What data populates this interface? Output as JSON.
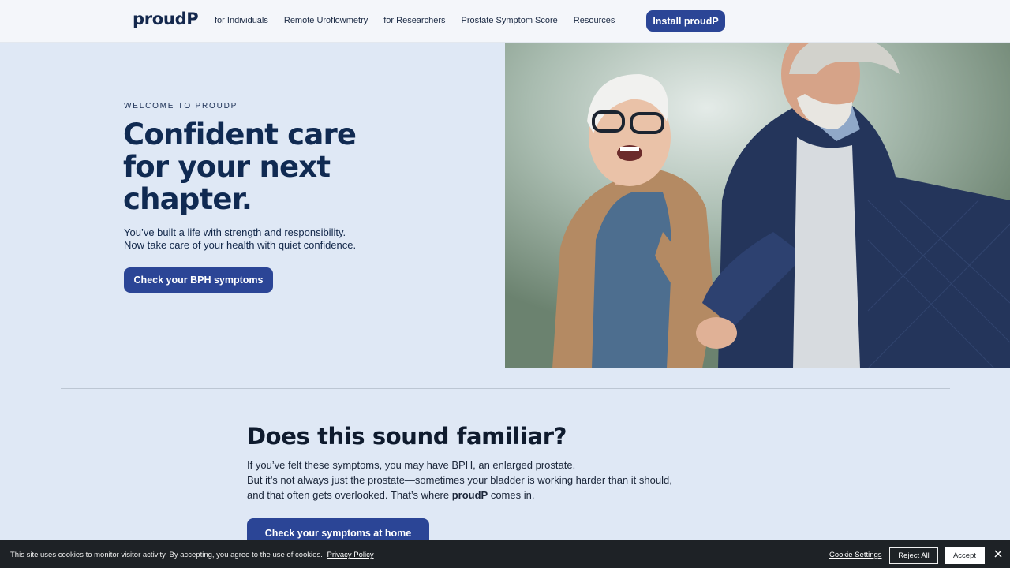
{
  "nav": {
    "logo": "proudP",
    "links": [
      "for Individuals",
      "Remote Uroflowmetry",
      "for Researchers",
      "Prostate Symptom Score",
      "Resources"
    ],
    "install_label": "Install proudP"
  },
  "hero": {
    "eyebrow": "WELCOME TO PROUDP",
    "title_lines": [
      "Confident care",
      "for your next",
      "chapter."
    ],
    "subtitle_lines": [
      "You’ve built a life with strength and responsibility.",
      "Now take care of your health with quiet confidence."
    ],
    "cta_label": "Check your BPH symptoms"
  },
  "section": {
    "title": "Does this sound familiar?",
    "line1": "If you’ve felt these symptoms, you may have BPH, an enlarged prostate.",
    "line2": "But it’s not always just the prostate—sometimes your bladder is working harder than it should,",
    "line3_pre": "and that often gets overlooked. That’s where ",
    "line3_brand": "proudP",
    "line3_post": " comes in.",
    "cta_label": "Check your symptoms at home"
  },
  "cookie": {
    "text": "This site uses cookies to monitor visitor activity. By accepting, you agree to the use of cookies.",
    "privacy_label": "Privacy Policy",
    "settings_label": "Cookie Settings",
    "reject_label": "Reject All",
    "accept_label": "Accept"
  },
  "colors": {
    "primary": "#2b4596",
    "background": "#dfe8f5",
    "nav_bg": "#f4f6fa",
    "heading": "#102a52",
    "cookie_bar": "#1e2226"
  }
}
